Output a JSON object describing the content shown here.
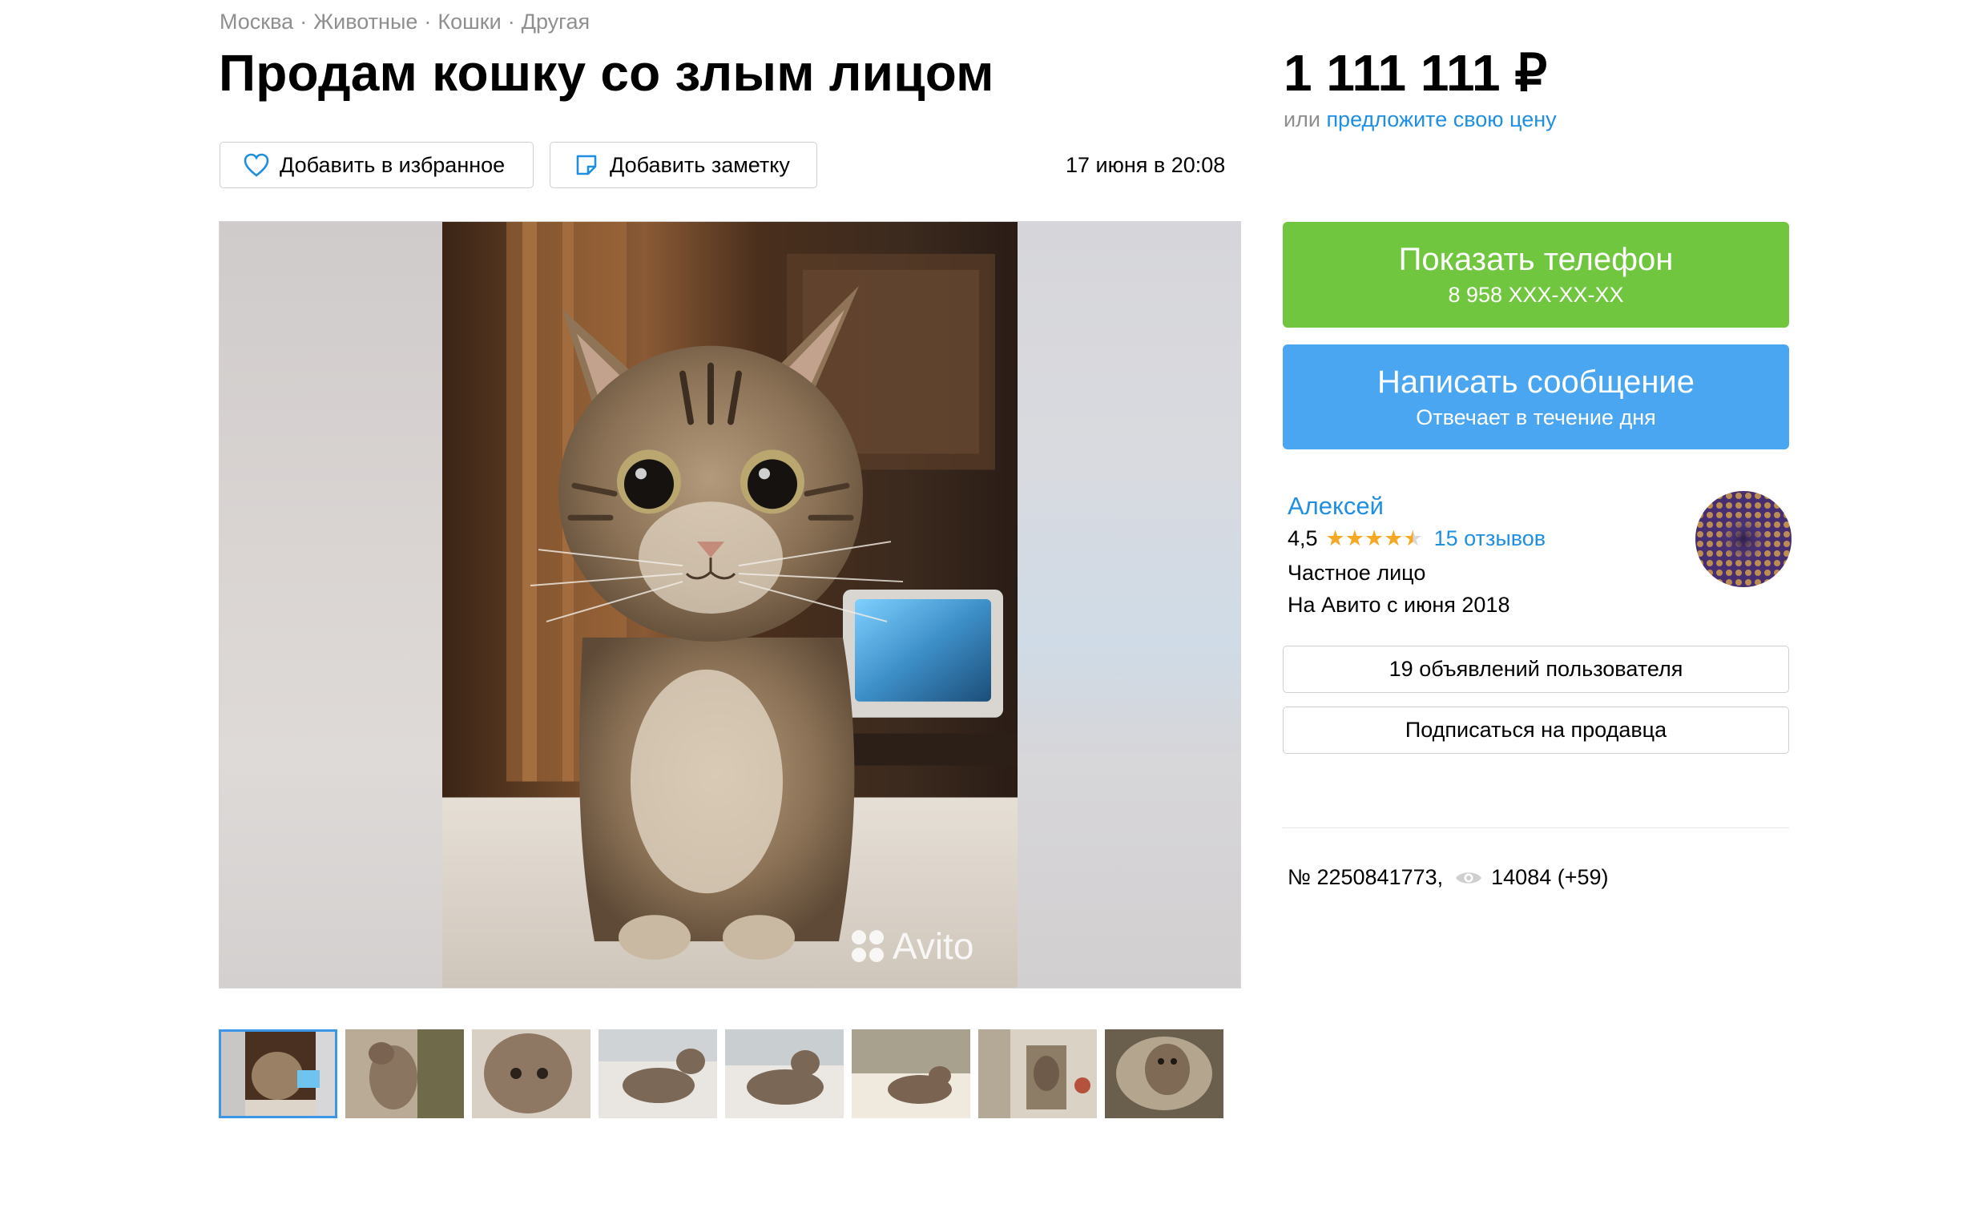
{
  "breadcrumb": [
    "Москва",
    "Животные",
    "Кошки",
    "Другая"
  ],
  "title": "Продам кошку со злым лицом",
  "actions": {
    "favorite_label": "Добавить в избранное",
    "note_label": "Добавить заметку"
  },
  "date": "17 июня в 20:08",
  "gallery": {
    "watermark": "Avito",
    "thumbnail_count": 8,
    "active_index": 0
  },
  "price": {
    "value": "1 111 111 ₽",
    "offer_prefix": "или",
    "offer_link": "предложите свою цену"
  },
  "contact": {
    "phone_label": "Показать телефон",
    "phone_masked": "8 958 XXX-XX-XX",
    "message_label": "Написать сообщение",
    "message_sub": "Отвечает в течение дня"
  },
  "seller": {
    "name": "Алексей",
    "rating": "4,5",
    "rating_value": 4.5,
    "reviews": "15 отзывов",
    "type": "Частное лицо",
    "since": "На Авито с июня 2018",
    "ads_button": "19 объявлений пользователя",
    "subscribe_button": "Подписаться на продавца"
  },
  "meta": {
    "ad_number": "№ 2250841773,",
    "views": "14084 (+59)"
  },
  "colors": {
    "green": "#71c63f",
    "blue": "#4aa6f1",
    "link": "#1e8fe1",
    "star": "#f6a823"
  }
}
